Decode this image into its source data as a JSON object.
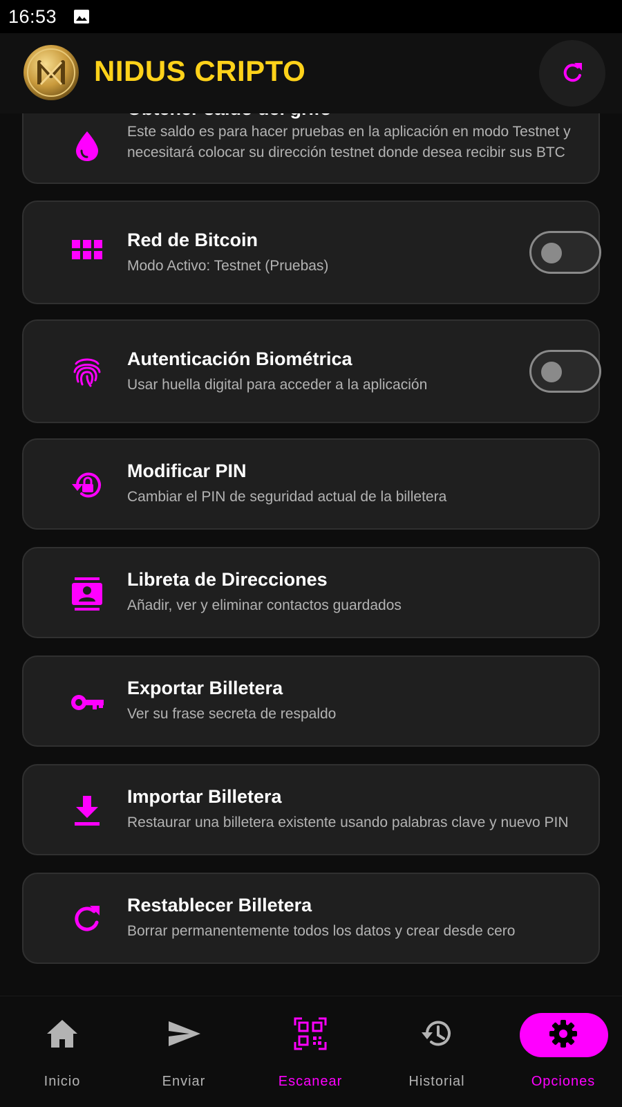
{
  "status_bar": {
    "time": "16:53"
  },
  "header": {
    "title": "NIDUS CRIPTO"
  },
  "colors": {
    "accent": "#ff00ff",
    "brand_yellow": "#ffd21a",
    "card_bg": "#1f1f1f"
  },
  "options": [
    {
      "id": "faucet",
      "icon": "drop-icon",
      "title": "Obtener saldo del grifo",
      "subtitle": "Este saldo es para hacer pruebas en la aplicación en modo Testnet y necesitará colocar su dirección testnet donde desea recibir sus BTC"
    },
    {
      "id": "network",
      "icon": "grid-icon",
      "title": "Red de Bitcoin",
      "subtitle": "Modo Activo: Testnet (Pruebas)",
      "toggle": false
    },
    {
      "id": "biometric",
      "icon": "fingerprint-icon",
      "title": "Autenticación Biométrica",
      "subtitle": "Usar huella digital para acceder a la aplicación",
      "toggle": false
    },
    {
      "id": "pin",
      "icon": "lock-reset-icon",
      "title": "Modificar PIN",
      "subtitle": "Cambiar el PIN de seguridad actual de la billetera"
    },
    {
      "id": "contacts",
      "icon": "contacts-icon",
      "title": "Libreta de Direcciones",
      "subtitle": "Añadir, ver y eliminar contactos guardados"
    },
    {
      "id": "export",
      "icon": "key-icon",
      "title": "Exportar Billetera",
      "subtitle": "Ver su frase secreta de respaldo"
    },
    {
      "id": "import",
      "icon": "download-icon",
      "title": "Importar Billetera",
      "subtitle": "Restaurar una billetera existente usando palabras clave y nuevo PIN"
    },
    {
      "id": "reset",
      "icon": "refresh-icon",
      "title": "Restablecer Billetera",
      "subtitle": "Borrar permanentemente todos los datos y crear desde cero"
    }
  ],
  "nav": [
    {
      "icon": "home-icon",
      "label": "Inicio"
    },
    {
      "icon": "send-icon",
      "label": "Enviar"
    },
    {
      "icon": "qr-scan-icon",
      "label": "Escanear"
    },
    {
      "icon": "history-icon",
      "label": "Historial"
    },
    {
      "icon": "gear-icon",
      "label": "Opciones",
      "selected": true
    }
  ]
}
